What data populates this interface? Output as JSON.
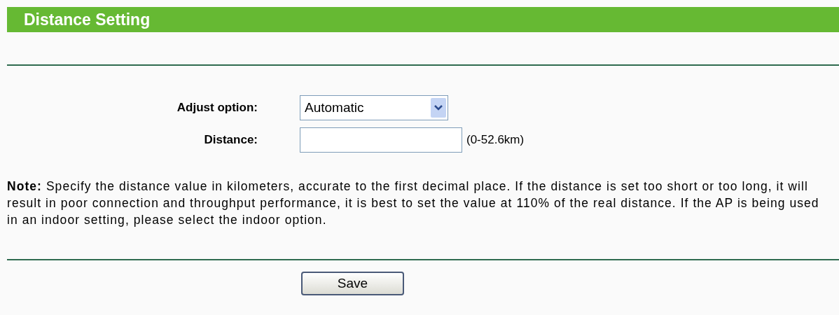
{
  "header": {
    "title": "Distance Setting"
  },
  "form": {
    "fields": [
      {
        "kind": "select",
        "label": "Adjust option:",
        "value": "Automatic"
      },
      {
        "kind": "text",
        "label": "Distance:",
        "hint": "(0-52.6km)"
      }
    ]
  },
  "note": "**Note:** Specify the distance value in kilometers, accurate to the first decimal place. If the distance is set too short or too long, it will result in poor connection and throughput performance, it is best to set the value at 110% of the real distance. If the AP is being used in an indoor setting, please select the indoor option.",
  "buttons": [
    "Save"
  ]
}
